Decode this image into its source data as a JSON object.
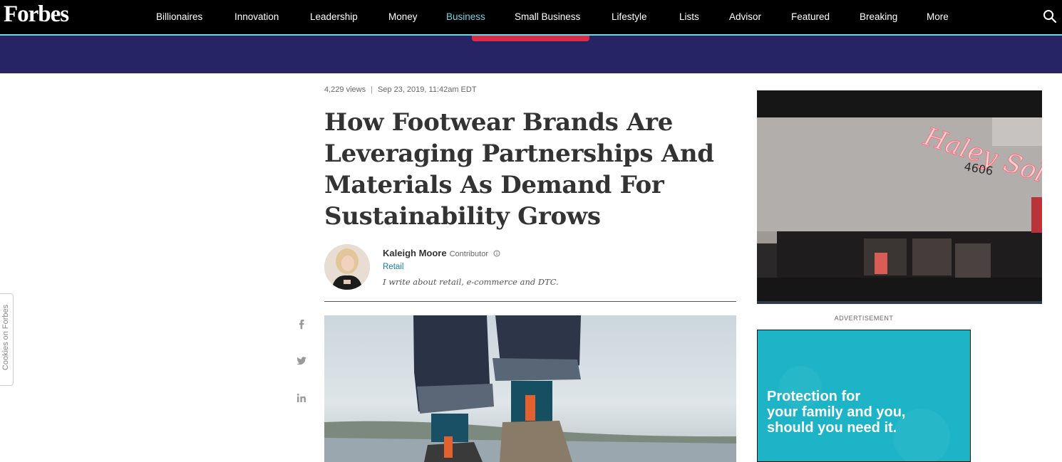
{
  "brand": "Forbes",
  "nav": {
    "items": [
      {
        "label": "Billionaires"
      },
      {
        "label": "Innovation"
      },
      {
        "label": "Leadership"
      },
      {
        "label": "Money"
      },
      {
        "label": "Business"
      },
      {
        "label": "Small Business"
      },
      {
        "label": "Lifestyle"
      },
      {
        "label": "Lists"
      },
      {
        "label": "Advisor"
      },
      {
        "label": "Featured"
      },
      {
        "label": "Breaking"
      },
      {
        "label": "More"
      }
    ],
    "active": "Business",
    "search_icon": "search-icon"
  },
  "article": {
    "views": "4,229 views",
    "separator": "|",
    "date": "Sep 23, 2019, 11:42am EDT",
    "headline": "How Footwear Brands Are Leveraging Partnerships And Materials As Demand For Sustainability Grows",
    "author": {
      "name": "Kaleigh Moore",
      "role": "Contributor",
      "info_icon": "info-icon",
      "section": "Retail",
      "bio": "I write about retail, e-commerce and DTC."
    },
    "share_icons": [
      "facebook-icon",
      "twitter-icon",
      "linkedin-icon"
    ]
  },
  "sidebar": {
    "video_sign": "Haley Solar",
    "video_number": "4606",
    "ad_label": "ADVERTISEMENT",
    "ad_text_line1": "Protection for",
    "ad_text_line2": "your family and you,",
    "ad_text_line3": "should you need it."
  },
  "cookie_tab": "Cookies on Forbes",
  "colors": {
    "nav_bg": "#000000",
    "accent": "#7ad3e0",
    "banner": "#262462",
    "banner_button": "#d62d4a",
    "link": "#1582a8",
    "ad_bg": "#1cb4c6"
  }
}
